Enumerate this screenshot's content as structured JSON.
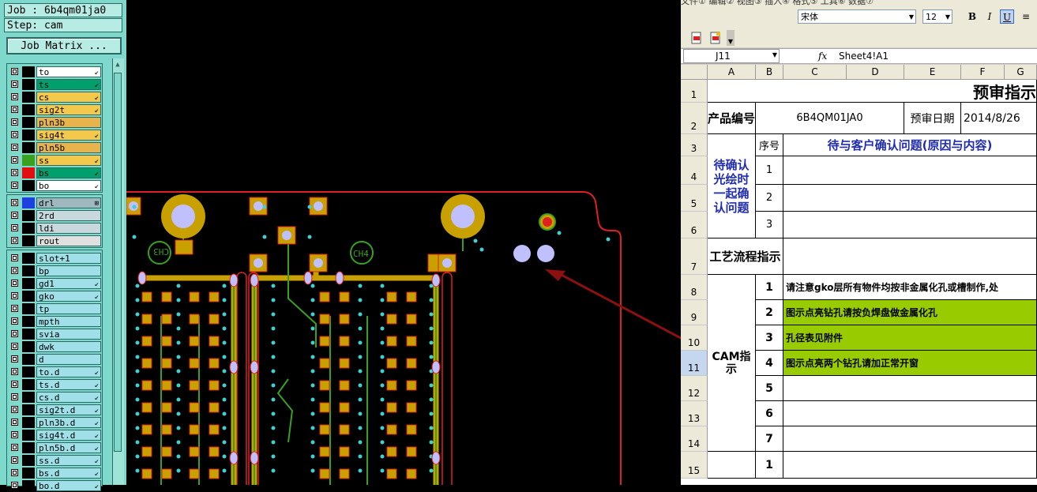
{
  "cam": {
    "job_line": "Job : 6b4qm01ja0",
    "step_line": "Step: cam",
    "job_matrix_button": "Job Matrix ...",
    "board_layers": [
      {
        "name": "to",
        "color": "#ffffff",
        "sw": "#000000",
        "tag": "↙"
      },
      {
        "name": "ts",
        "color": "#009f6b",
        "sw": "#000000",
        "tag": "↙"
      },
      {
        "name": "cs",
        "color": "#f4c84a",
        "sw": "#000000",
        "tag": "↙"
      },
      {
        "name": "sig2t",
        "color": "#f4c84a",
        "sw": "#000000",
        "tag": "↙"
      },
      {
        "name": "pln3b",
        "color": "#e8b34a",
        "sw": "#000000",
        "tag": ""
      },
      {
        "name": "sig4t",
        "color": "#f4c84a",
        "sw": "#000000",
        "tag": "↙"
      },
      {
        "name": "pln5b",
        "color": "#e8b34a",
        "sw": "#000000",
        "tag": ""
      },
      {
        "name": "ss",
        "color": "#f4c84a",
        "sw": "#3aa020",
        "tag": "↙"
      },
      {
        "name": "bs",
        "color": "#009f6b",
        "sw": "#e01010",
        "tag": "↙"
      },
      {
        "name": "bo",
        "color": "#ffffff",
        "sw": "#000000",
        "tag": "↙"
      }
    ],
    "drill_layers": [
      {
        "name": "drl",
        "color": "#9fb8c0",
        "sw": "#1f40e0",
        "tag": "⊞"
      },
      {
        "name": "2rd",
        "color": "#c8d8dc",
        "sw": "#000000",
        "tag": ""
      },
      {
        "name": "ldi",
        "color": "#c8d8dc",
        "sw": "#000000",
        "tag": ""
      },
      {
        "name": "rout",
        "color": "#e0e0e0",
        "sw": "#000000",
        "tag": ""
      }
    ],
    "misc_layers": [
      {
        "name": "slot+1",
        "tag": ""
      },
      {
        "name": "bp",
        "tag": ""
      },
      {
        "name": "gd1",
        "tag": "↙"
      },
      {
        "name": "gko",
        "tag": "↙"
      },
      {
        "name": "tp",
        "tag": ""
      },
      {
        "name": "mpth",
        "tag": ""
      },
      {
        "name": "svia",
        "tag": ""
      },
      {
        "name": "dwk",
        "tag": ""
      },
      {
        "name": "d",
        "tag": ""
      },
      {
        "name": "to.d",
        "tag": "↙"
      },
      {
        "name": "ts.d",
        "tag": "↙"
      },
      {
        "name": "cs.d",
        "tag": "↙"
      },
      {
        "name": "sig2t.d",
        "tag": "↙"
      },
      {
        "name": "pln3b.d",
        "tag": "↙"
      },
      {
        "name": "sig4t.d",
        "tag": "↙"
      },
      {
        "name": "pln5b.d",
        "tag": "↙"
      },
      {
        "name": "ss.d",
        "tag": "↙"
      },
      {
        "name": "bs.d",
        "tag": "↙"
      },
      {
        "name": "bo.d",
        "tag": "↙"
      }
    ],
    "misc_color": "#9fe0e8",
    "silk_labels": [
      "CH3",
      "CH4"
    ]
  },
  "excel": {
    "menu_partial": "文件①  编辑②  视图③  插入④  格式⑤  工具⑥  数据⑦",
    "font_name": "宋体",
    "font_size": "12",
    "bold_label": "B",
    "italic_label": "I",
    "underline_label": "U",
    "name_box": "J11",
    "fx_label": "fx",
    "formula": "Sheet4!A1",
    "columns": [
      "A",
      "B",
      "C",
      "D",
      "E",
      "F",
      "G"
    ],
    "rows": [
      "1",
      "2",
      "3",
      "4",
      "5",
      "6",
      "7",
      "8",
      "9",
      "10",
      "11",
      "12",
      "13",
      "14",
      "15"
    ],
    "title": "预审指示",
    "product_no_label": "产品编号",
    "product_no": "6B4QM01JA0",
    "review_date_label": "预审日期",
    "review_date": "2014/8/26",
    "seq_label": "序号",
    "pending_header": "待与客户确认问题(原因与内容)",
    "pending_group": "待确认光绘时一起确认问题",
    "pending_nums": [
      "1",
      "2",
      "3"
    ],
    "process_label": "工艺流程指示",
    "cam_label": "CAM指示",
    "cam_items": [
      {
        "num": "1",
        "text": "请注意gko层所有物件均按非金属化孔或槽制作,处",
        "green": false
      },
      {
        "num": "2",
        "text": "图示点亮钻孔请按负焊盘做金属化孔",
        "green": true
      },
      {
        "num": "3",
        "text": "孔径表见附件",
        "green": true
      },
      {
        "num": "4",
        "text": "图示点亮两个钻孔请加正常开窗",
        "green": true
      },
      {
        "num": "5",
        "text": "",
        "green": false
      },
      {
        "num": "6",
        "text": "",
        "green": false
      },
      {
        "num": "7",
        "text": "",
        "green": false
      }
    ],
    "row15_num": "1"
  }
}
